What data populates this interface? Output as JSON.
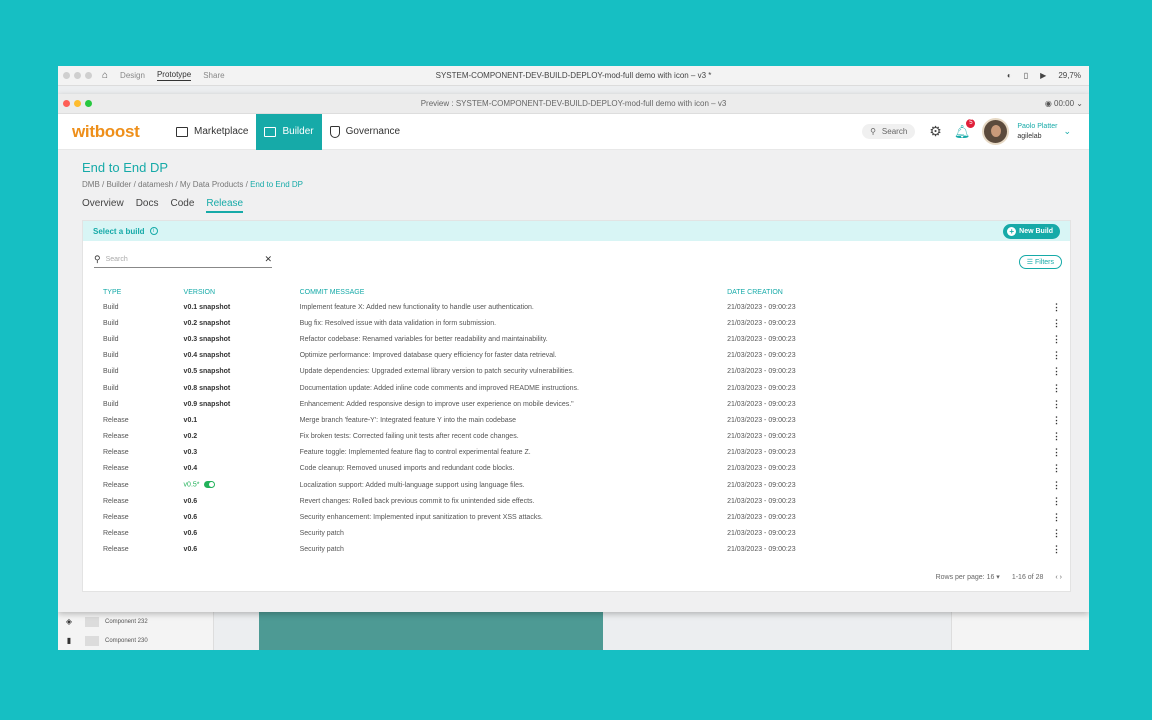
{
  "outer": {
    "tabs": [
      "Design",
      "Prototype",
      "Share"
    ],
    "active_tab": "Prototype",
    "title": "SYSTEM-COMPONENT-DEV-BUILD-DEPLOY-mod-full demo with icon – v3 *",
    "zoom": "29,7%",
    "layers": [
      "Component 232",
      "Component 230"
    ]
  },
  "preview": {
    "title": "Preview : SYSTEM-COMPONENT-DEV-BUILD-DEPLOY-mod-full demo with icon – v3",
    "timer": "00:00"
  },
  "header": {
    "logo": "witboost",
    "nav": [
      "Marketplace",
      "Builder",
      "Governance"
    ],
    "search_label": "Search",
    "notifications": "5",
    "user_name": "Paolo Platter",
    "user_org": "agilelab"
  },
  "page": {
    "title": "End to End DP",
    "breadcrumb": "DMB / Builder / datamesh / My Data Products / ",
    "breadcrumb_current": "End to End DP",
    "tabs": [
      "Overview",
      "Docs",
      "Code",
      "Release"
    ],
    "active_tab": "Release"
  },
  "panel": {
    "heading": "Select a build",
    "new_build": "New Build",
    "search_placeholder": "Search",
    "filters": "Filters",
    "columns": [
      "TYPE",
      "VERSION",
      "COMMIT MESSAGE",
      "DATE CREATION"
    ],
    "rows": [
      {
        "type": "Build",
        "version": "v0.1 snapshot",
        "message": "Implement feature X: Added new functionality to handle user authentication.",
        "date": "21/03/2023 - 09:00:23"
      },
      {
        "type": "Build",
        "version": "v0.2 snapshot",
        "message": "Bug fix: Resolved issue with data validation in form submission.",
        "date": "21/03/2023 - 09:00:23"
      },
      {
        "type": "Build",
        "version": "v0.3 snapshot",
        "message": "Refactor codebase: Renamed variables for better readability and maintainability.",
        "date": "21/03/2023 - 09:00:23"
      },
      {
        "type": "Build",
        "version": "v0.4 snapshot",
        "message": "Optimize performance: Improved database query efficiency for faster data retrieval.",
        "date": "21/03/2023 - 09:00:23"
      },
      {
        "type": "Build",
        "version": "v0.5 snapshot",
        "message": "Update dependencies: Upgraded external library version to patch security vulnerabilities.",
        "date": "21/03/2023 - 09:00:23"
      },
      {
        "type": "Build",
        "version": "v0.8 snapshot",
        "message": "Documentation update: Added inline code comments and improved README instructions.",
        "date": "21/03/2023 - 09:00:23"
      },
      {
        "type": "Build",
        "version": "v0.9 snapshot",
        "message": "Enhancement: Added responsive design to improve user experience on mobile devices.\"",
        "date": "21/03/2023 - 09:00:23"
      },
      {
        "type": "Release",
        "version": "v0.1",
        "message": "Merge branch 'feature-Y': Integrated feature Y into the main codebase",
        "date": "21/03/2023 - 09:00:23"
      },
      {
        "type": "Release",
        "version": "v0.2",
        "message": "Fix broken tests: Corrected failing unit tests after recent code changes.",
        "date": "21/03/2023 - 09:00:23"
      },
      {
        "type": "Release",
        "version": "v0.3",
        "message": "Feature toggle: Implemented feature flag to control experimental feature Z.",
        "date": "21/03/2023 - 09:00:23"
      },
      {
        "type": "Release",
        "version": "v0.4",
        "message": "Code cleanup: Removed unused imports and redundant code blocks.",
        "date": "21/03/2023 - 09:00:23"
      },
      {
        "type": "Release",
        "version": "v0.5*",
        "message": "Localization support: Added multi-language support using language files.",
        "date": "21/03/2023 - 09:00:23",
        "deployed": true
      },
      {
        "type": "Release",
        "version": "v0.6",
        "message": "Revert changes: Rolled back previous commit to fix unintended side effects.",
        "date": "21/03/2023 - 09:00:23"
      },
      {
        "type": "Release",
        "version": "v0.6",
        "message": "Security enhancement: Implemented input sanitization to prevent XSS attacks.",
        "date": "21/03/2023 - 09:00:23"
      },
      {
        "type": "Release",
        "version": "v0.6",
        "message": "Security patch",
        "date": "21/03/2023 - 09:00:23"
      },
      {
        "type": "Release",
        "version": "v0.6",
        "message": "Security patch",
        "date": "21/03/2023 - 09:00:23"
      }
    ],
    "rows_per_page_label": "Rows per page:",
    "rows_per_page": "16",
    "page_range": "1-16 of 28"
  },
  "colors": {
    "accent": "#16aaa8",
    "brand": "#ee8f1a",
    "background": "#16bfc3",
    "deployed": "#22b25a"
  }
}
